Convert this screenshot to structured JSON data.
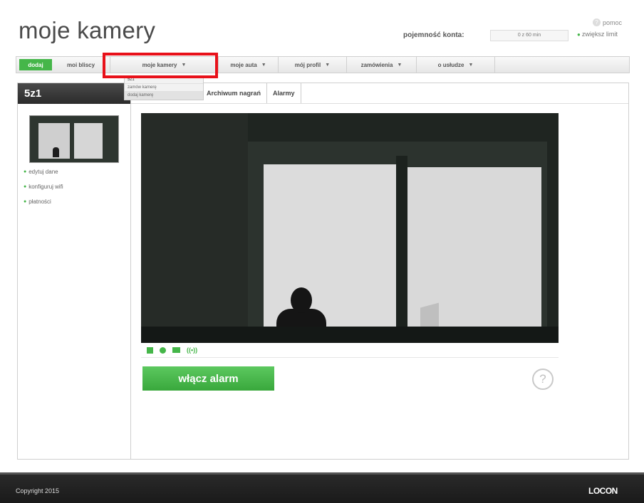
{
  "header": {
    "title": "moje kamery",
    "help_label": "pomoc",
    "capacity_label": "pojemność konta:",
    "capacity_value": "0 z 60 min",
    "limit_link": "zwiększ limit"
  },
  "nav": {
    "items": [
      {
        "label": "dodaj"
      },
      {
        "label": "moi bliscy"
      },
      {
        "label": "moje kamery",
        "caret": "▼"
      },
      {
        "label": "moje auta",
        "caret": "▼"
      },
      {
        "label": "mój profil",
        "caret": "▼"
      },
      {
        "label": "zamówienia",
        "caret": "▼"
      },
      {
        "label": "o usłudze",
        "caret": "▼"
      }
    ]
  },
  "dropdown": {
    "items": [
      "5z1",
      "zamów kamerę",
      "dodaj kamerę"
    ]
  },
  "sidebar": {
    "title": "5z1",
    "links": [
      "edytuj dane",
      "konfiguruj wifi",
      "płatności"
    ]
  },
  "tabs": [
    "Archiwum nagrań",
    "Alarmy"
  ],
  "controls": {
    "icons": [
      "stop-icon",
      "record-icon",
      "mail-icon",
      "signal-icon"
    ],
    "signal_glyph": "((•))"
  },
  "alarm_button": "włącz alarm",
  "help_glyph": "?",
  "footer": {
    "copyright": "Copyright 2015",
    "brand": "LOCON"
  },
  "colors": {
    "accent": "#45b649",
    "highlight": "#e8111a",
    "footer": "#1f1f1f"
  }
}
